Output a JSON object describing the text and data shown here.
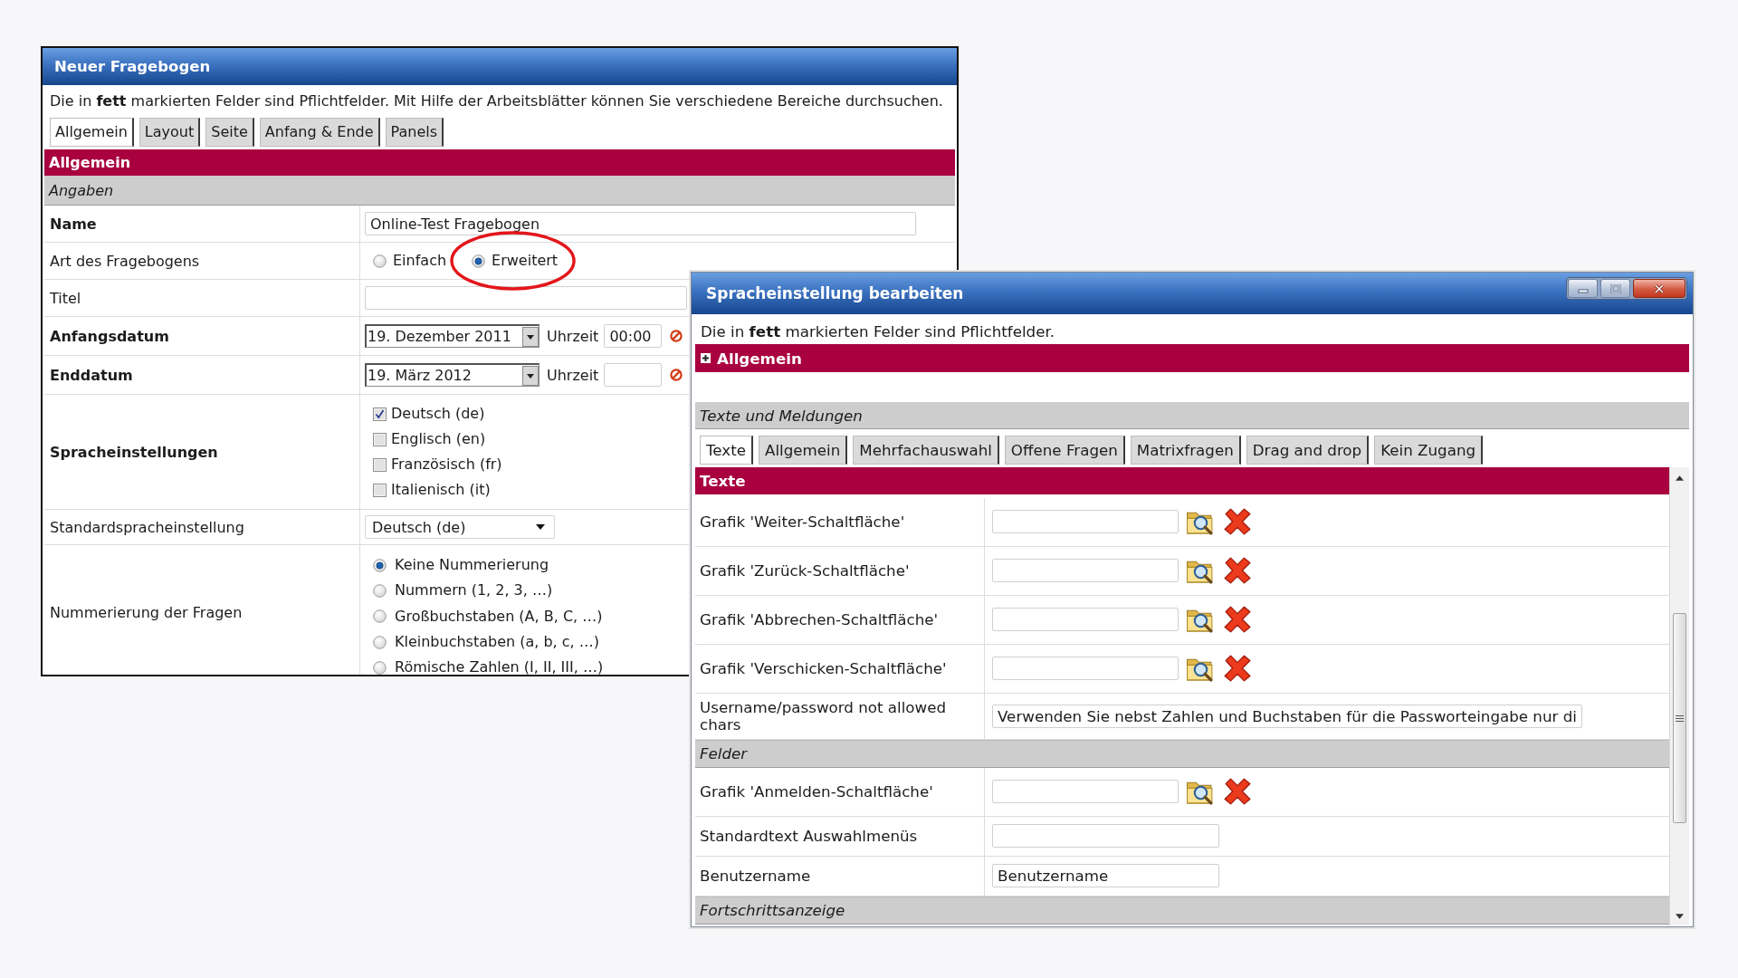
{
  "questionnaire_window": {
    "title": "Neuer Fragebogen",
    "intro": "Die in **fett** markierten Felder sind Pflichtfelder. Mit Hilfe der Arbeitsblätter können Sie verschiedene Bereiche durchsuchen.",
    "tabs": [
      {
        "label": "Allgemein",
        "selected": true
      },
      {
        "label": "Layout",
        "selected": false
      },
      {
        "label": "Seite",
        "selected": false
      },
      {
        "label": "Anfang & Ende",
        "selected": false
      },
      {
        "label": "Panels",
        "selected": false
      }
    ],
    "section_title": "Allgemein",
    "group_title": "Angaben",
    "rows": [
      {
        "kind": "text",
        "label": "Name",
        "required": true,
        "value": "Online-Test Fragebogen"
      },
      {
        "kind": "radiorow",
        "label": "Art des Fragebogens",
        "required": false,
        "options": [
          {
            "label": "Einfach",
            "selected": false
          },
          {
            "label": "Erweitert",
            "selected": true,
            "circled": true
          }
        ]
      },
      {
        "kind": "text",
        "label": "Titel",
        "required": false
      },
      {
        "kind": "date",
        "label": "Anfangsdatum",
        "required": true,
        "date": "19. Dezember 2011",
        "time_label": "Uhrzeit",
        "time": "00:00"
      },
      {
        "kind": "date",
        "label": "Enddatum",
        "required": true,
        "date": "19. März 2012",
        "time_label": "Uhrzeit"
      },
      {
        "kind": "checkboxes",
        "label": "Spracheinstellungen",
        "required": true,
        "options": [
          {
            "label": "Deutsch (de)",
            "checked": true
          },
          {
            "label": "Englisch (en)",
            "checked": false
          },
          {
            "label": "Französisch (fr)",
            "checked": false
          },
          {
            "label": "Italienisch (it)",
            "checked": false
          }
        ]
      },
      {
        "kind": "select",
        "label": "Standardspracheinstellung",
        "required": false,
        "value": "Deutsch (de)"
      },
      {
        "kind": "radiolist",
        "label": "Nummerierung der Fragen",
        "required": false,
        "options": [
          {
            "label": "Keine Nummerierung",
            "selected": true
          },
          {
            "label": "Nummern (1, 2, 3, …)",
            "selected": false
          },
          {
            "label": "Großbuchstaben (A, B, C, …)",
            "selected": false
          },
          {
            "label": "Kleinbuchstaben (a, b, c, …)",
            "selected": false
          },
          {
            "label": "Römische Zahlen (I, II, III, …)",
            "selected": false
          }
        ]
      }
    ]
  },
  "language_window": {
    "title": "Spracheinstellung bearbeiten",
    "intro": "Die in **fett** markierten Felder sind Pflichtfelder.",
    "panel": {
      "title": "Allgemein",
      "expanded": false
    },
    "group_title": "Texte und Meldungen",
    "tabs": [
      {
        "label": "Texte",
        "selected": true
      },
      {
        "label": "Allgemein",
        "selected": false
      },
      {
        "label": "Mehrfachauswahl",
        "selected": false
      },
      {
        "label": "Offene Fragen",
        "selected": false
      },
      {
        "label": "Matrixfragen",
        "selected": false
      },
      {
        "label": "Drag and drop",
        "selected": false
      },
      {
        "label": "Kein Zugang",
        "selected": false
      }
    ],
    "section_title": "Texte",
    "rows": [
      {
        "kind": "image",
        "label": "Grafik 'Weiter-Schaltfläche'"
      },
      {
        "kind": "image",
        "label": "Grafik 'Zurück-Schaltfläche'"
      },
      {
        "kind": "image",
        "label": "Grafik 'Abbrechen-Schaltfläche'"
      },
      {
        "kind": "image",
        "label": "Grafik 'Verschicken-Schaltfläche'"
      },
      {
        "kind": "longtext",
        "label": "Username/password not allowed chars",
        "value": "Verwenden Sie nebst Zahlen und Buchstaben für die Passworteingabe nur di"
      },
      {
        "kind": "group",
        "label": "Felder"
      },
      {
        "kind": "image",
        "label": "Grafik 'Anmelden-Schaltfläche'"
      },
      {
        "kind": "text",
        "label": "Standardtext Auswahlmenüs"
      },
      {
        "kind": "text",
        "label": "Benutzername",
        "value": "Benutzername"
      },
      {
        "kind": "group",
        "label": "Fortschrittsanzeige"
      }
    ]
  }
}
